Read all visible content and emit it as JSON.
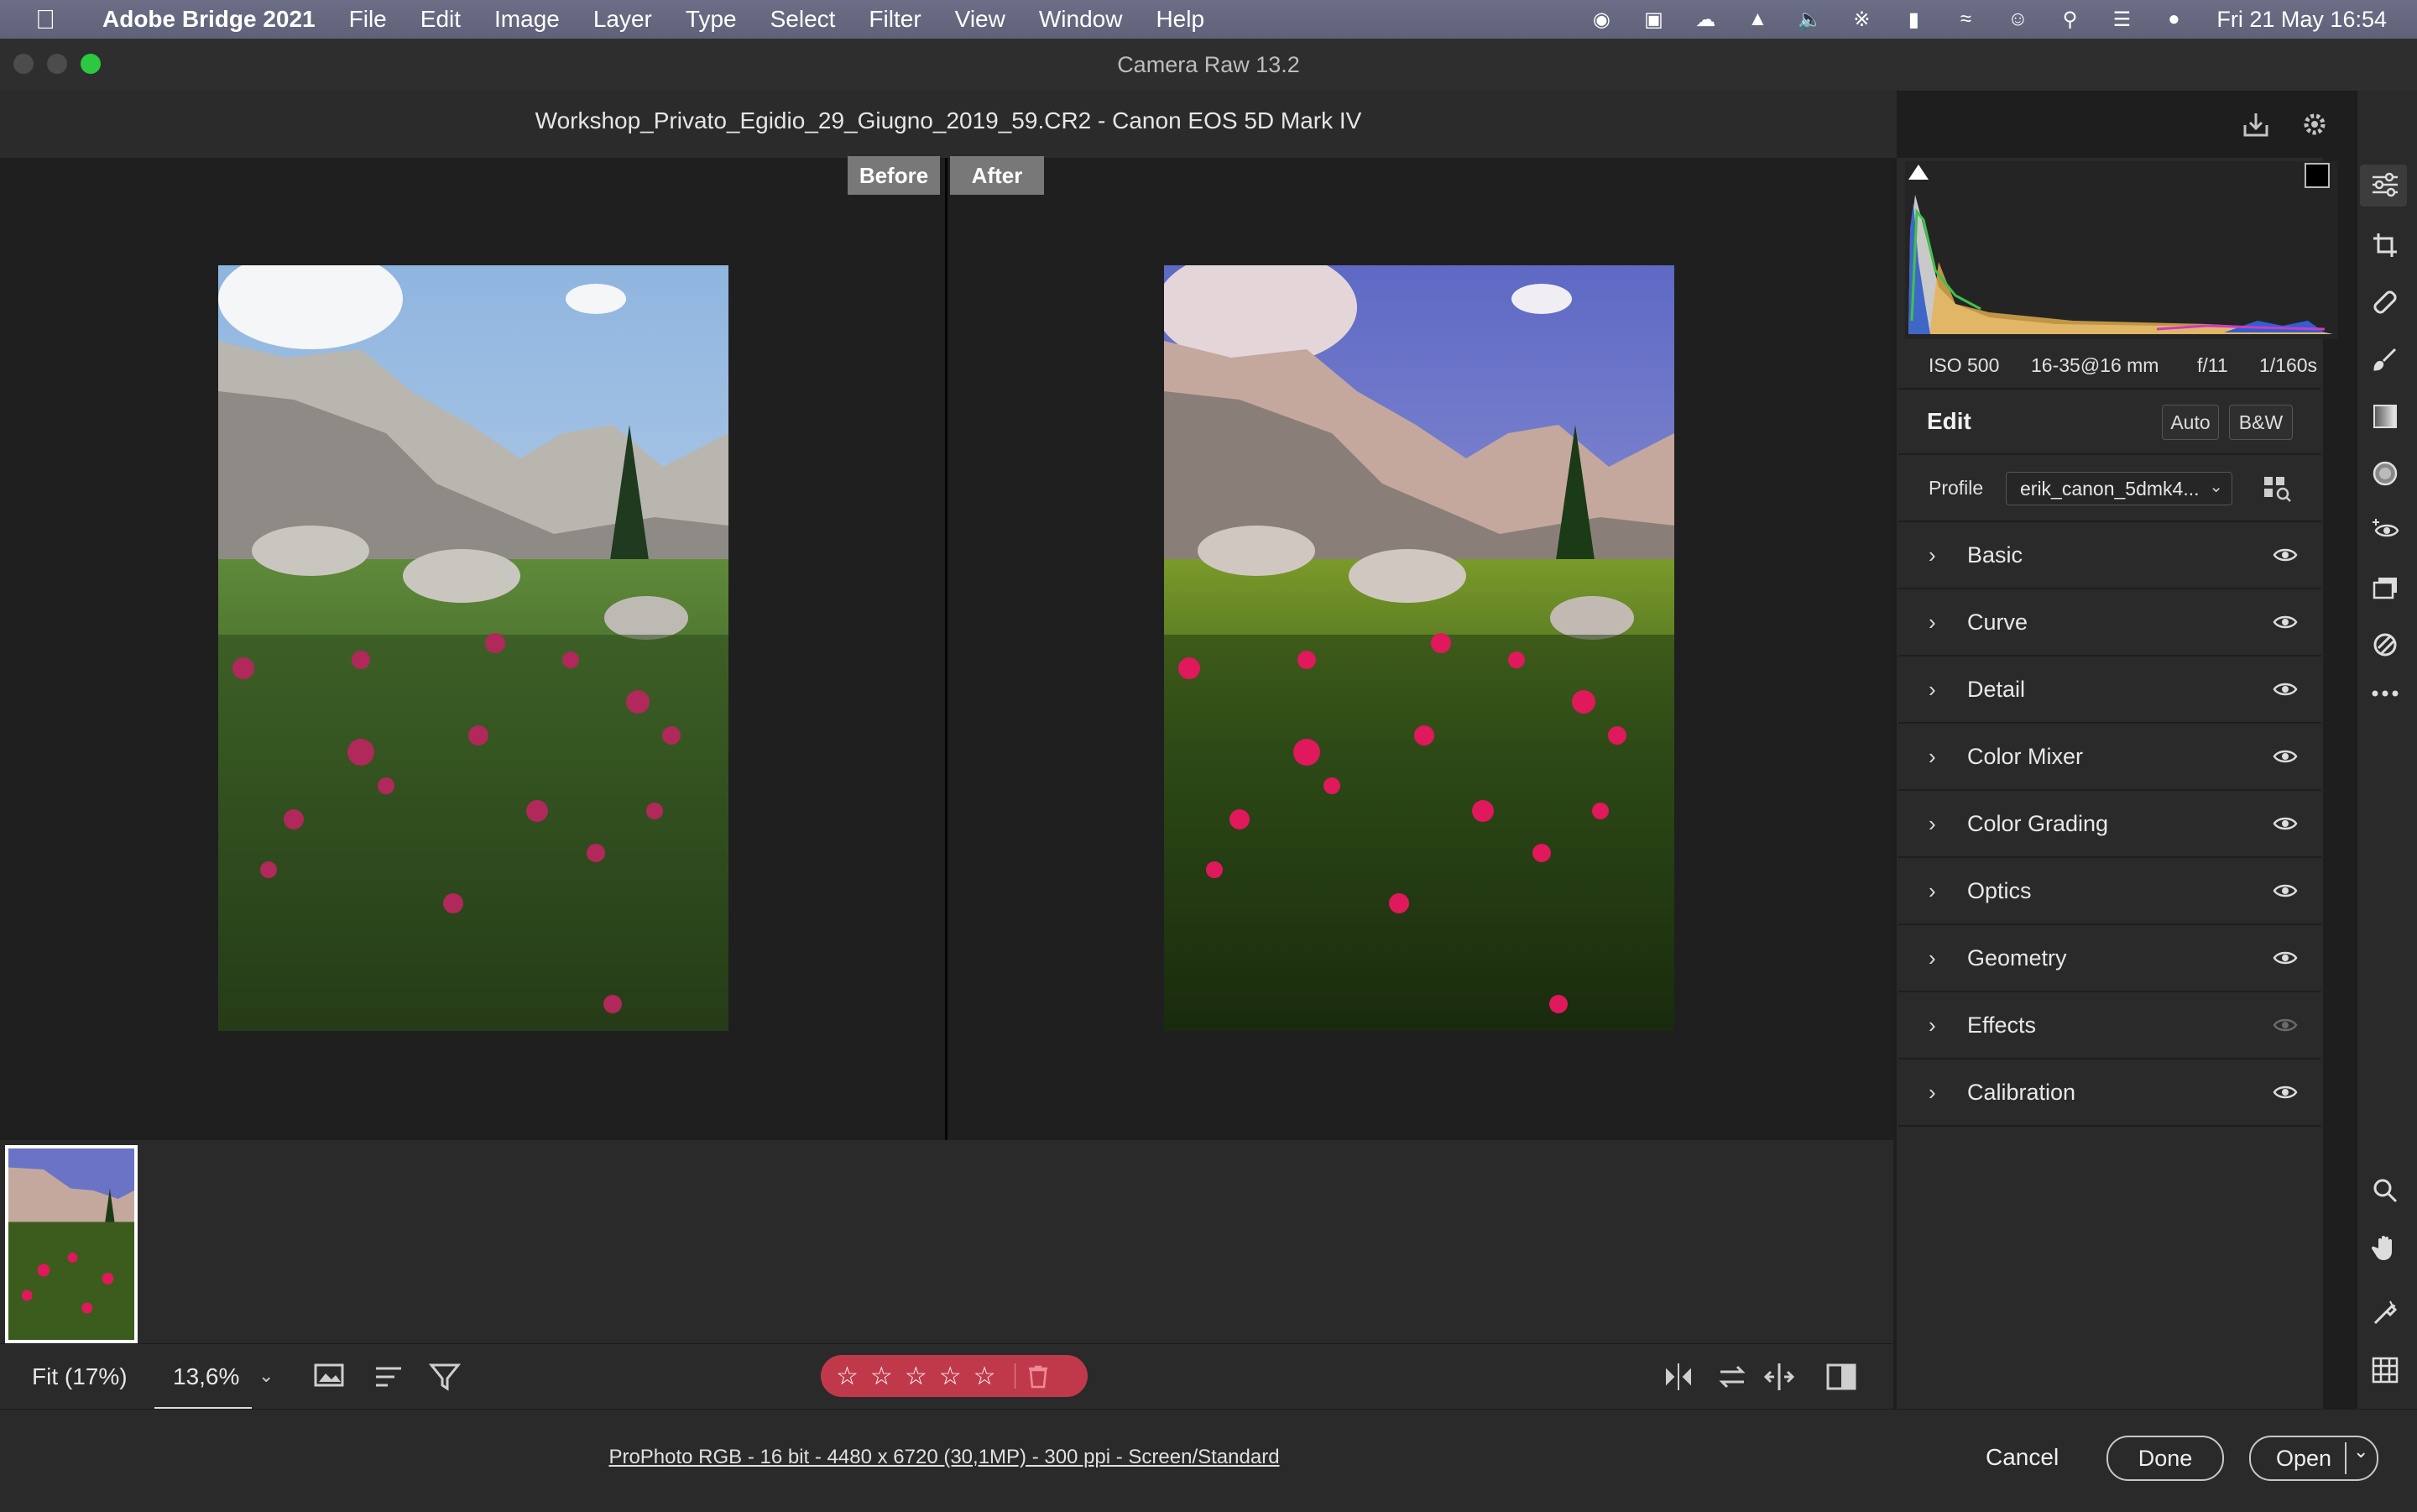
{
  "menubar": {
    "app_name": "Adobe Bridge 2021",
    "items": [
      "File",
      "Edit",
      "Image",
      "Layer",
      "Type",
      "Select",
      "Filter",
      "View",
      "Window",
      "Help"
    ],
    "datetime": "Fri 21 May  16:54"
  },
  "window": {
    "title": "Camera Raw 13.2",
    "file_title": "Workshop_Privato_Egidio_29_Giugno_2019_59.CR2  -  Canon EOS 5D Mark IV"
  },
  "view": {
    "before_label": "Before",
    "after_label": "After"
  },
  "histogram": {
    "iso": "ISO 500",
    "lens": "16-35@16 mm",
    "aperture": "f/11",
    "shutter": "1/160s"
  },
  "edit": {
    "title": "Edit",
    "auto_label": "Auto",
    "bw_label": "B&W",
    "profile_label": "Profile",
    "profile_value": "erik_canon_5dmk4..."
  },
  "sections": [
    {
      "label": "Basic"
    },
    {
      "label": "Curve"
    },
    {
      "label": "Detail"
    },
    {
      "label": "Color Mixer"
    },
    {
      "label": "Color Grading"
    },
    {
      "label": "Optics"
    },
    {
      "label": "Geometry"
    },
    {
      "label": "Effects"
    },
    {
      "label": "Calibration"
    }
  ],
  "bottombar": {
    "fit_label": "Fit (17%)",
    "zoom_value": "13,6%",
    "rating": 0
  },
  "status": {
    "workflow_link": "ProPhoto RGB - 16 bit - 4480 x 6720 (30,1MP) - 300 ppi - Screen/Standard",
    "cancel_label": "Cancel",
    "done_label": "Done",
    "open_label": "Open"
  }
}
